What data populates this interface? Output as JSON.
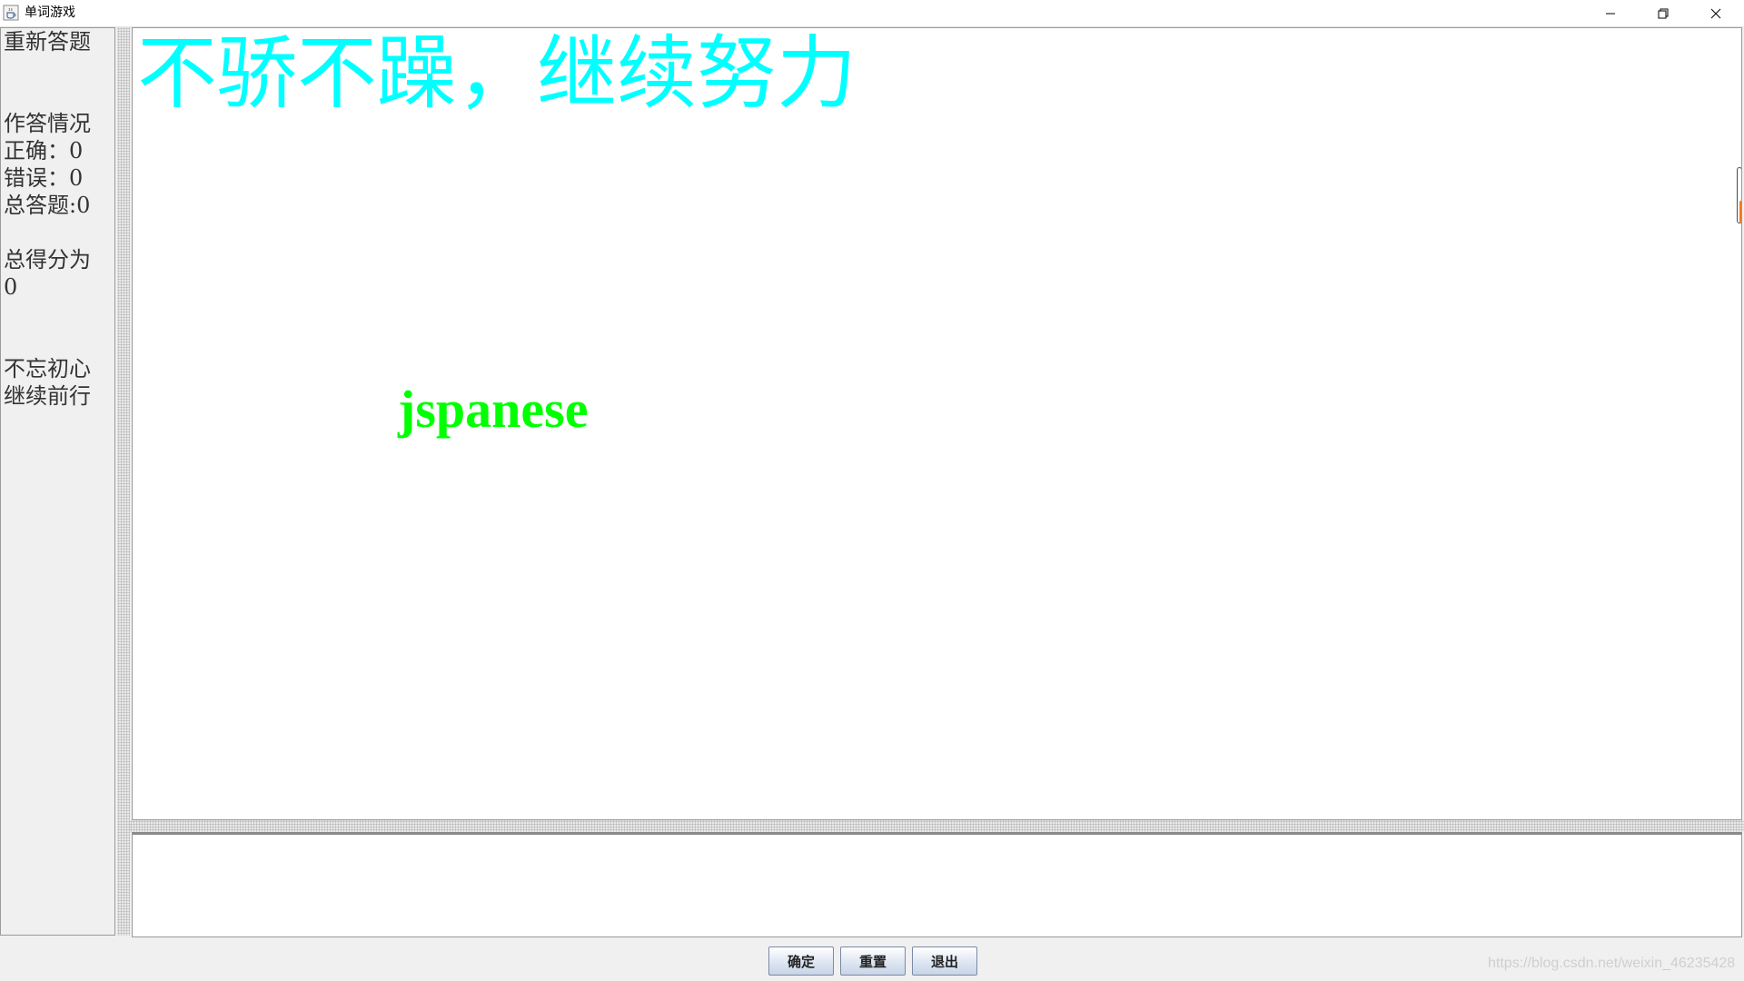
{
  "window": {
    "title": "单词游戏"
  },
  "icons": {
    "app": "java-cup-icon",
    "minimize": "minimize-icon",
    "maximize": "restore-icon",
    "close": "close-icon"
  },
  "sidebar": {
    "restart_label": "重新答题",
    "status_heading": "作答情况",
    "correct": "正确：0",
    "wrong": "错误：0",
    "total_questions": "总答题:0",
    "score_label": "总得分为",
    "score_value": "0",
    "motto_line1": "不忘初心",
    "motto_line2": "继续前行"
  },
  "main": {
    "banner": "不骄不躁，继续努力",
    "word": "jspanese",
    "banner_color": "#00ffff",
    "word_color": "#00ff00"
  },
  "answer": {
    "value": "",
    "placeholder": ""
  },
  "buttons": {
    "confirm": "确定",
    "reset": "重置",
    "exit": "退出"
  },
  "watermark": "https://blog.csdn.net/weixin_46235428"
}
